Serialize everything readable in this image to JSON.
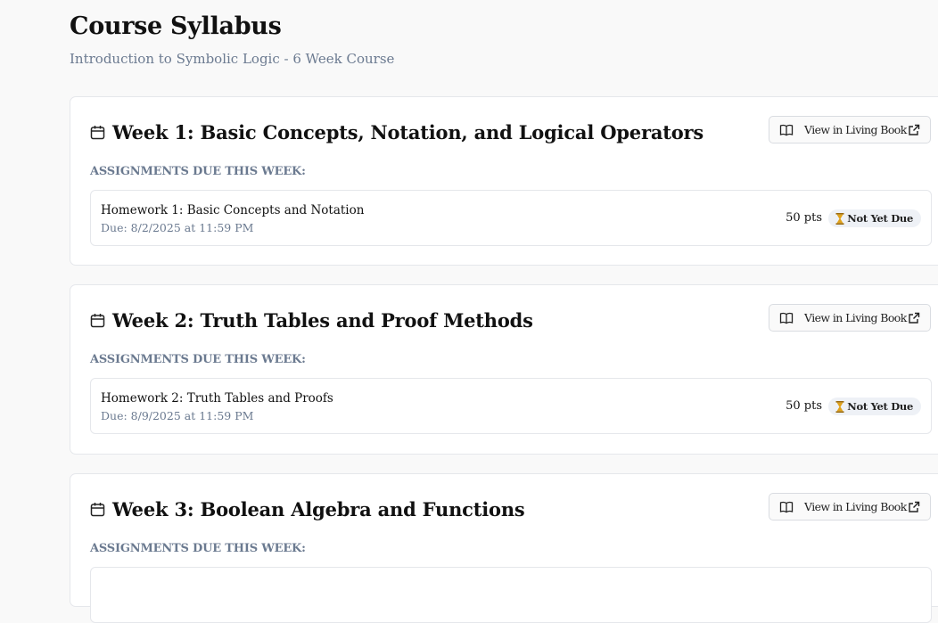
{
  "page": {
    "title": "Course Syllabus",
    "subtitle": "Introduction to Symbolic Logic - 6 Week Course"
  },
  "weeks": [
    {
      "title": "Week 1: Basic Concepts, Notation, and Logical Operators",
      "book_label": "View in Living Book",
      "section_label": "ASSIGNMENTS DUE THIS WEEK:",
      "assignment": {
        "name": "Homework 1: Basic Concepts and Notation",
        "due": "Due: 8/2/2025 at 11:59 PM",
        "points": "50 pts",
        "status": "Not Yet Due"
      }
    },
    {
      "title": "Week 2: Truth Tables and Proof Methods",
      "book_label": "View in Living Book",
      "section_label": "ASSIGNMENTS DUE THIS WEEK:",
      "assignment": {
        "name": "Homework 2: Truth Tables and Proofs",
        "due": "Due: 8/9/2025 at 11:59 PM",
        "points": "50 pts",
        "status": "Not Yet Due"
      }
    },
    {
      "title": "Week 3: Boolean Algebra and Functions",
      "book_label": "View in Living Book",
      "section_label": "ASSIGNMENTS DUE THIS WEEK:"
    }
  ],
  "icons": {
    "calendar": "calendar-icon",
    "book": "book-open-icon",
    "external": "external-link-icon",
    "status": "hourglass-icon"
  },
  "colors": {
    "muted_text": "#6b7a90",
    "badge_bg": "#eef1f6",
    "hourglass": "#e0a21b",
    "card_border": "#e5e7eb"
  }
}
